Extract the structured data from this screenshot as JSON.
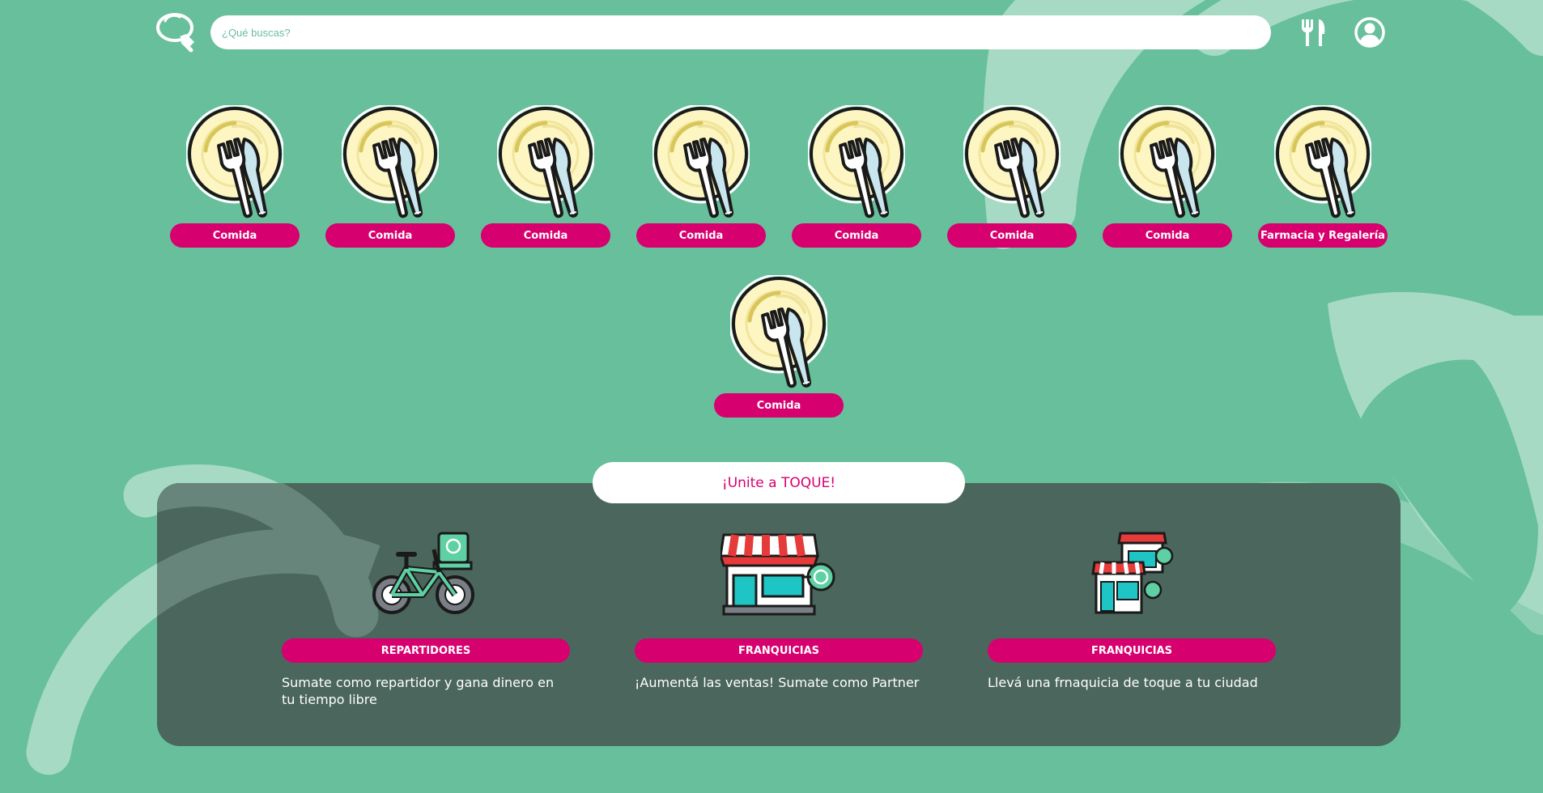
{
  "colors": {
    "background": "#67bf9c",
    "accent": "#d7006f",
    "panel": "#4b665c",
    "white": "#ffffff"
  },
  "header": {
    "logo_icon": "toque-logo-icon",
    "search": {
      "placeholder": "¿Qué buscas?",
      "value": ""
    },
    "nav_icons": [
      "fork-knife-icon",
      "user-account-icon"
    ]
  },
  "categories": [
    {
      "label": "Comida",
      "icon": "plate-cutlery-icon"
    },
    {
      "label": "Comida",
      "icon": "plate-cutlery-icon"
    },
    {
      "label": "Comida",
      "icon": "plate-cutlery-icon"
    },
    {
      "label": "Comida",
      "icon": "plate-cutlery-icon"
    },
    {
      "label": "Comida",
      "icon": "plate-cutlery-icon"
    },
    {
      "label": "Comida",
      "icon": "plate-cutlery-icon"
    },
    {
      "label": "Comida",
      "icon": "plate-cutlery-icon"
    },
    {
      "label": "Farmacia y Regalería",
      "icon": "plate-cutlery-icon"
    },
    {
      "label": "Comida",
      "icon": "plate-cutlery-icon"
    }
  ],
  "join": {
    "title": "¡Unite a TOQUE!",
    "cards": [
      {
        "icon": "delivery-bike-icon",
        "button": "REPARTIDORES",
        "text": "Sumate como repartidor y gana dinero en tu tiempo libre"
      },
      {
        "icon": "storefront-icon",
        "button": "FRANQUICIAS",
        "text": "¡Aumentá las ventas! Sumate como Partner"
      },
      {
        "icon": "franchise-stores-icon",
        "button": "FRANQUICIAS",
        "text": "Llevá una frnaquicia de toque a tu ciudad"
      }
    ]
  }
}
